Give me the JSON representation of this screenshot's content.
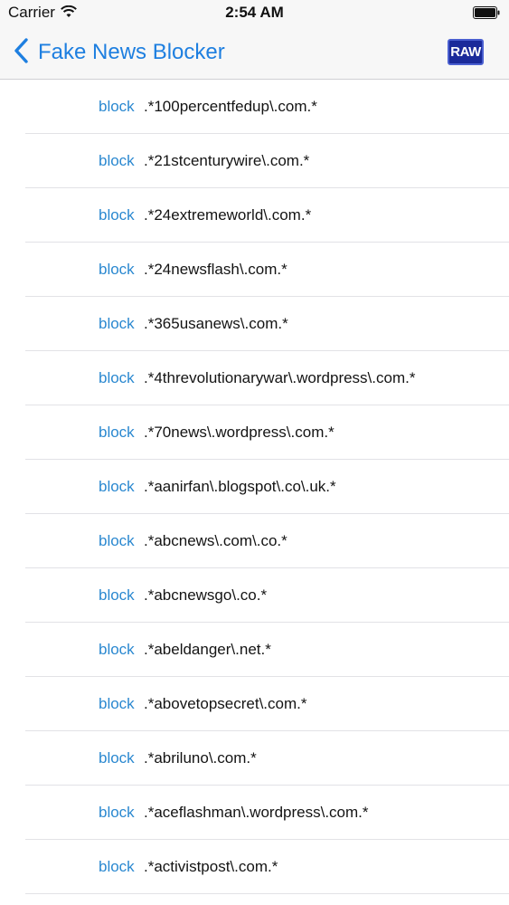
{
  "status_bar": {
    "carrier": "Carrier",
    "time": "2:54 AM"
  },
  "nav": {
    "back_label": "Fake News Blocker",
    "raw_label": "RAW"
  },
  "colors": {
    "accent": "#1e7fe0",
    "action": "#2a88d0",
    "raw_button": "#1a2a9a"
  },
  "rules": [
    {
      "action": "block",
      "pattern": ".*100percentfedup\\.com.*"
    },
    {
      "action": "block",
      "pattern": ".*21stcenturywire\\.com.*"
    },
    {
      "action": "block",
      "pattern": ".*24extremeworld\\.com.*"
    },
    {
      "action": "block",
      "pattern": ".*24newsflash\\.com.*"
    },
    {
      "action": "block",
      "pattern": ".*365usanews\\.com.*"
    },
    {
      "action": "block",
      "pattern": ".*4threvolutionarywar\\.wordpress\\.com.*"
    },
    {
      "action": "block",
      "pattern": ".*70news\\.wordpress\\.com.*"
    },
    {
      "action": "block",
      "pattern": ".*aanirfan\\.blogspot\\.co\\.uk.*"
    },
    {
      "action": "block",
      "pattern": ".*abcnews\\.com\\.co.*"
    },
    {
      "action": "block",
      "pattern": ".*abcnewsgo\\.co.*"
    },
    {
      "action": "block",
      "pattern": ".*abeldanger\\.net.*"
    },
    {
      "action": "block",
      "pattern": ".*abovetopsecret\\.com.*"
    },
    {
      "action": "block",
      "pattern": ".*abriluno\\.com.*"
    },
    {
      "action": "block",
      "pattern": ".*aceflashman\\.wordpress\\.com.*"
    },
    {
      "action": "block",
      "pattern": ".*activistpost\\.com.*"
    }
  ]
}
